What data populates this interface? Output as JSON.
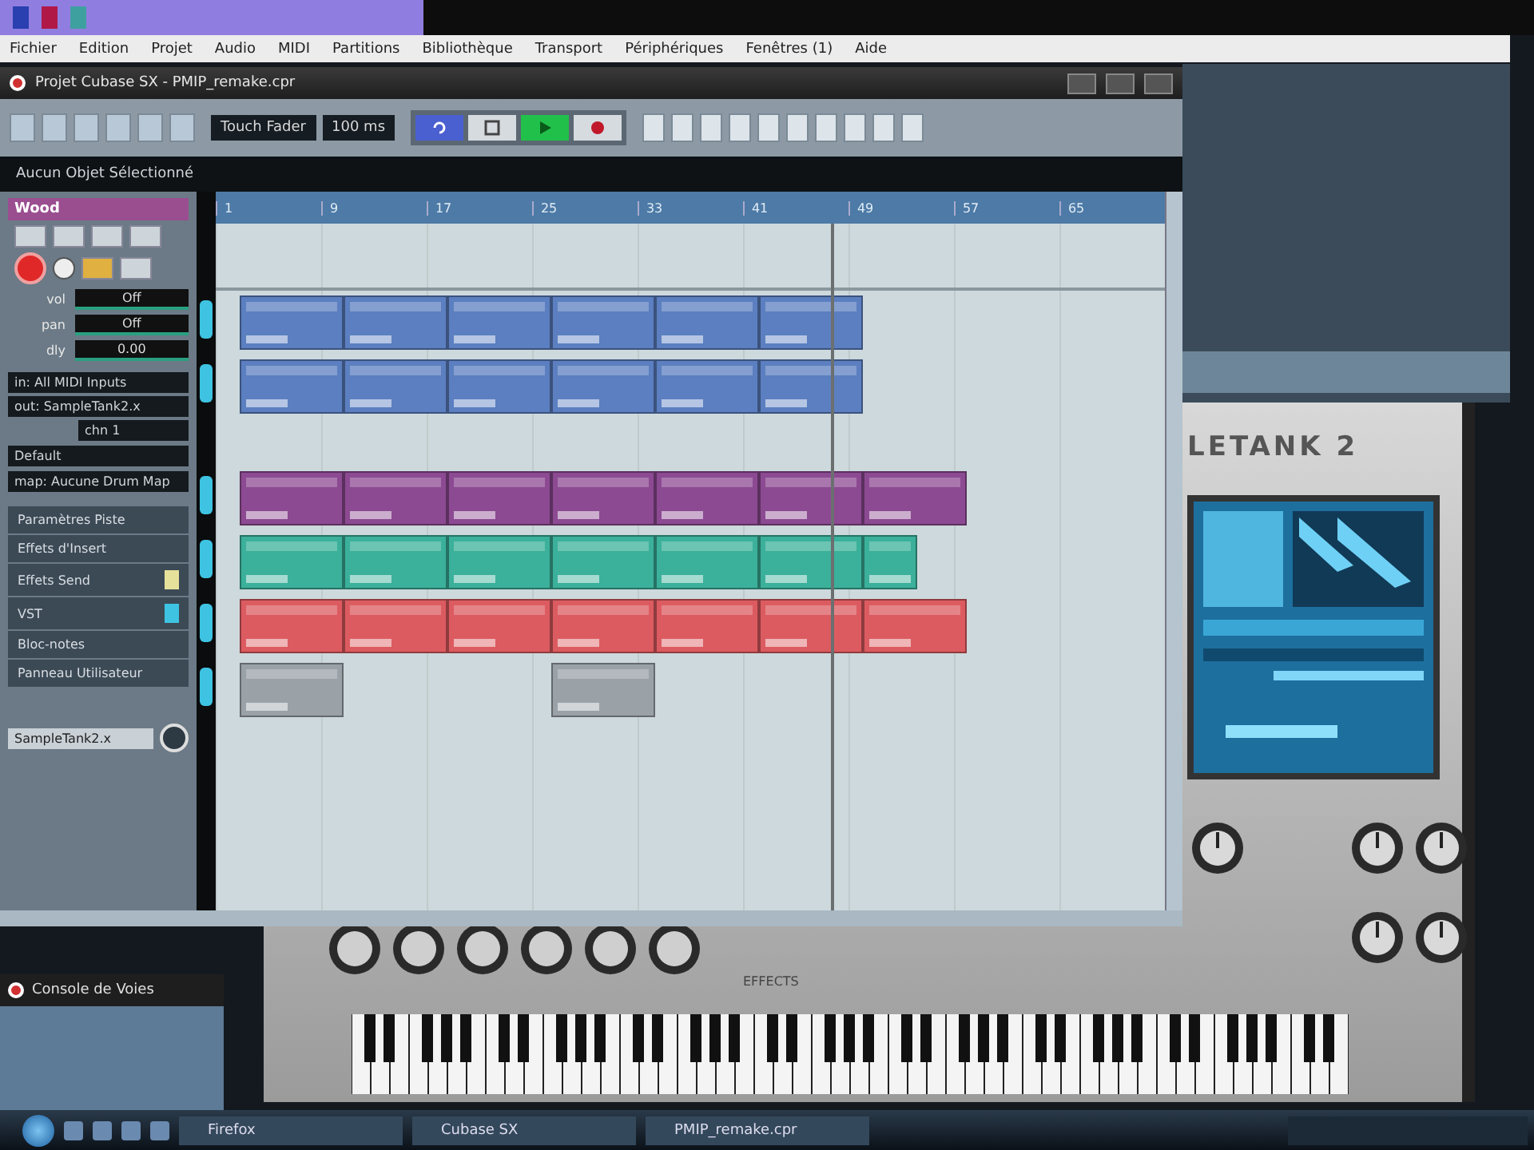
{
  "menu": [
    "Fichier",
    "Edition",
    "Projet",
    "Audio",
    "MIDI",
    "Partitions",
    "Bibliothèque",
    "Transport",
    "Périphériques",
    "Fenêtres (1)",
    "Aide"
  ],
  "window": {
    "title": "Projet Cubase SX - PMIP_remake.cpr"
  },
  "toolbar": {
    "automation_mode": "Touch Fader",
    "time": "100 ms",
    "transport": [
      {
        "kind": "cycle",
        "on": true
      },
      {
        "kind": "stop",
        "on": false
      },
      {
        "kind": "play",
        "on": true
      },
      {
        "kind": "record",
        "on": false
      }
    ]
  },
  "info_line": "Aucun Objet Sélectionné",
  "inspector": {
    "track_name": "Wood",
    "readouts": [
      {
        "label": "vol",
        "value": "Off"
      },
      {
        "label": "pan",
        "value": "Off"
      },
      {
        "label": "dly",
        "value": "0.00"
      }
    ],
    "routing": [
      "in: All MIDI Inputs",
      "out: SampleTank2.x",
      "chn 1"
    ],
    "preset": "Default",
    "map": "map: Aucune Drum Map",
    "sections": [
      {
        "label": "Paramètres Piste"
      },
      {
        "label": "Effets d'Insert"
      },
      {
        "label": "Effets Send",
        "color": "#e6e19a"
      },
      {
        "label": "VST",
        "color": "#3ec3e2"
      },
      {
        "label": "Bloc-notes"
      },
      {
        "label": "Panneau Utilisateur"
      }
    ],
    "output": "SampleTank2.x"
  },
  "ruler": [
    "1",
    "9",
    "17",
    "25",
    "33",
    "41",
    "49",
    "57",
    "65"
  ],
  "tracks": [
    {
      "color": "#5b7fc0",
      "parts": [
        {
          "kind": "part"
        },
        {
          "kind": "part"
        },
        {
          "kind": "part"
        },
        {
          "kind": "part"
        },
        {
          "kind": "part"
        },
        {
          "kind": "part"
        }
      ]
    },
    {
      "color": "#5b7fc0",
      "parts": [
        {
          "kind": "part"
        },
        {
          "kind": "part"
        },
        {
          "kind": "part"
        },
        {
          "kind": "part"
        },
        {
          "kind": "part"
        },
        {
          "kind": "part"
        }
      ]
    },
    {
      "kind": "empty"
    },
    {
      "color": "#8c4a92",
      "parts": [
        {
          "kind": "part"
        },
        {
          "kind": "part"
        },
        {
          "kind": "part"
        },
        {
          "kind": "part"
        },
        {
          "kind": "part"
        },
        {
          "kind": "part"
        },
        {
          "kind": "part"
        }
      ]
    },
    {
      "color": "#3bb09a",
      "parts": [
        {
          "kind": "part"
        },
        {
          "kind": "part"
        },
        {
          "kind": "part"
        },
        {
          "kind": "part"
        },
        {
          "kind": "part"
        },
        {
          "kind": "part"
        },
        {
          "kind": "short"
        }
      ]
    },
    {
      "color": "#dc5b60",
      "parts": [
        {
          "kind": "part"
        },
        {
          "kind": "part"
        },
        {
          "kind": "part"
        },
        {
          "kind": "part"
        },
        {
          "kind": "part"
        },
        {
          "kind": "part"
        },
        {
          "kind": "part"
        }
      ]
    },
    {
      "color": "#9aa2a8",
      "parts": [
        {
          "kind": "part"
        },
        {
          "kind": "gap"
        },
        {
          "kind": "gap"
        },
        {
          "kind": "part"
        }
      ]
    }
  ],
  "plugin": {
    "logo": "LETANK 2",
    "effects_label": "EFFECTS"
  },
  "console": {
    "title": "Console de Voies"
  },
  "taskbar": {
    "tasks": [
      "Firefox",
      "Cubase SX",
      "PMIP_remake.cpr"
    ]
  }
}
